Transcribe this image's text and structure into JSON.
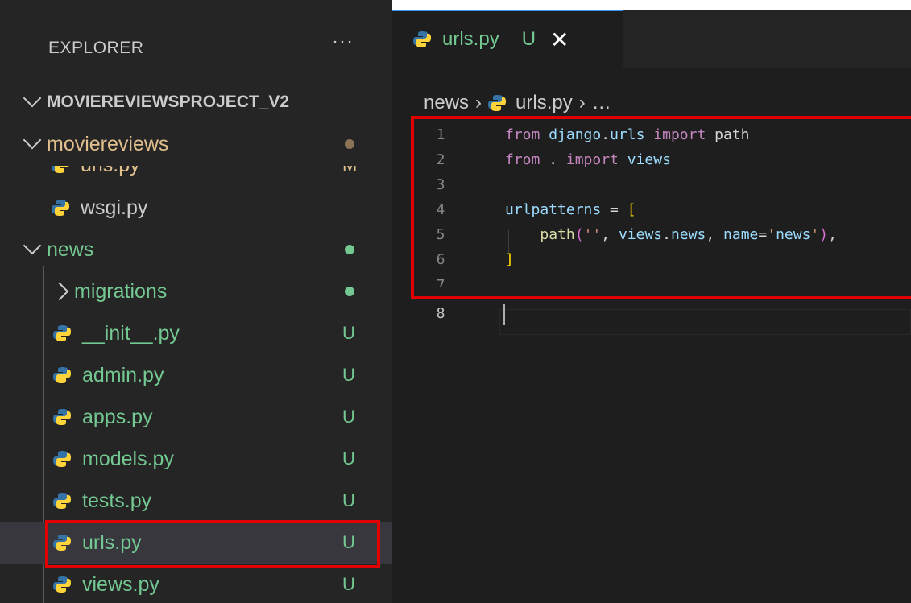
{
  "explorer": {
    "title": "EXPLORER",
    "more": "···",
    "project": "MOVIEREVIEWSPROJECT_V2",
    "items": [
      {
        "label": "moviereviews",
        "kind": "folder-open",
        "status": "dot-brown"
      },
      {
        "label": "urls.py",
        "kind": "file",
        "status": "M"
      },
      {
        "label": "wsgi.py",
        "kind": "file",
        "status": ""
      },
      {
        "label": "news",
        "kind": "folder-open",
        "status": "dot"
      },
      {
        "label": "migrations",
        "kind": "folder-closed",
        "status": "dot"
      },
      {
        "label": "__init__.py",
        "kind": "file",
        "status": "U"
      },
      {
        "label": "admin.py",
        "kind": "file",
        "status": "U"
      },
      {
        "label": "apps.py",
        "kind": "file",
        "status": "U"
      },
      {
        "label": "models.py",
        "kind": "file",
        "status": "U"
      },
      {
        "label": "tests.py",
        "kind": "file",
        "status": "U"
      },
      {
        "label": "urls.py",
        "kind": "file",
        "status": "U"
      },
      {
        "label": "views.py",
        "kind": "file",
        "status": "U"
      }
    ]
  },
  "tab": {
    "label": "urls.py",
    "status": "U",
    "close": "✕"
  },
  "breadcrumb": {
    "folder": "news",
    "sep": "›",
    "file": "urls.py",
    "more": "…"
  },
  "editor": {
    "lines": [
      {
        "n": "1",
        "text": "from django.urls import path"
      },
      {
        "n": "2",
        "text": "from . import views"
      },
      {
        "n": "3",
        "text": ""
      },
      {
        "n": "4",
        "text": "urlpatterns = ["
      },
      {
        "n": "5",
        "text": "    path('', views.news, name='news'),"
      },
      {
        "n": "6",
        "text": "]"
      },
      {
        "n": "7",
        "text": ""
      },
      {
        "n": "8",
        "text": ""
      }
    ]
  },
  "colors": {
    "untracked": "#73c991",
    "accent": "#3794ff",
    "highlight": "#e00000"
  },
  "icons": [
    "python-file-icon",
    "chevron-down-icon",
    "chevron-right-icon",
    "more-icon",
    "close-icon"
  ]
}
